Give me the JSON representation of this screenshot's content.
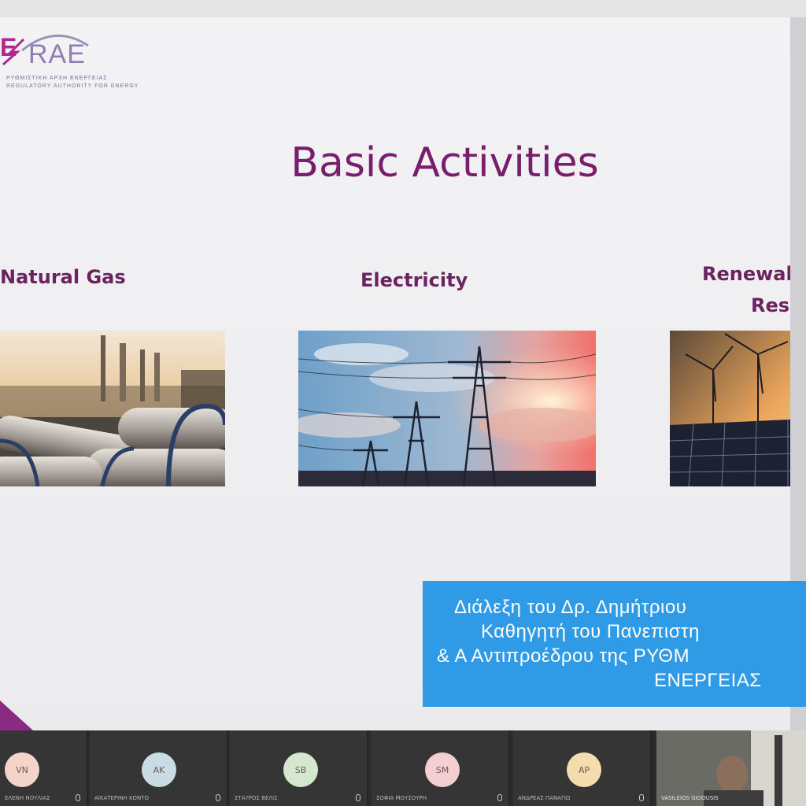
{
  "logo": {
    "mark": "E",
    "name": "RAE",
    "line1": "ΡΥΘΜΙΣΤΙΚΗ ΑΡΧΗ ΕΝΕΡΓΕΙΑΣ",
    "line2": "REGULATORY AUTHORITY FOR ENERGY",
    "accent": "#b0278d"
  },
  "slide": {
    "title": "Basic Activities",
    "title_color": "#7a1d6a",
    "activities": [
      {
        "label": "Natural Gas"
      },
      {
        "label": "Electricity"
      },
      {
        "label_line1": "Renewab",
        "label_line2": "Reso"
      }
    ]
  },
  "subtitle": {
    "line1": "Διάλεξη του Δρ. Δημήτριου",
    "line2": "Καθηγητή του Πανεπιστη",
    "line3": "& Α Αντιπροέδρου της ΡΥΘΜ",
    "line4": "ΕΝΕΡΓΕΙΑΣ",
    "background": "#2f9ae6"
  },
  "participants": [
    {
      "initials": "VN",
      "name": "ΕΛΕΝΗ ΝΟΥΛΙΑΣ",
      "avatar_color": "#f4d4c9"
    },
    {
      "initials": "AK",
      "name": "ΑΙΚΑΤΕΡΙΝΗ ΚΟΝΤΟ",
      "avatar_color": "#c9dce4"
    },
    {
      "initials": "SB",
      "name": "ΣΤΑΥΡΟΣ ΒΕΛΙΣ",
      "avatar_color": "#d6e7cf"
    },
    {
      "initials": "SM",
      "name": "ΣΟΦΙΑ ΜΟΥΣΟΥΡΗ",
      "avatar_color": "#f3cfd2"
    },
    {
      "initials": "AP",
      "name": "ΑΝΔΡΕΑΣ ΠΑΝΑΓΙΩ",
      "avatar_color": "#f5dcae"
    }
  ],
  "video_participant": {
    "name": "VASILEIOS GIDOUSIS"
  }
}
